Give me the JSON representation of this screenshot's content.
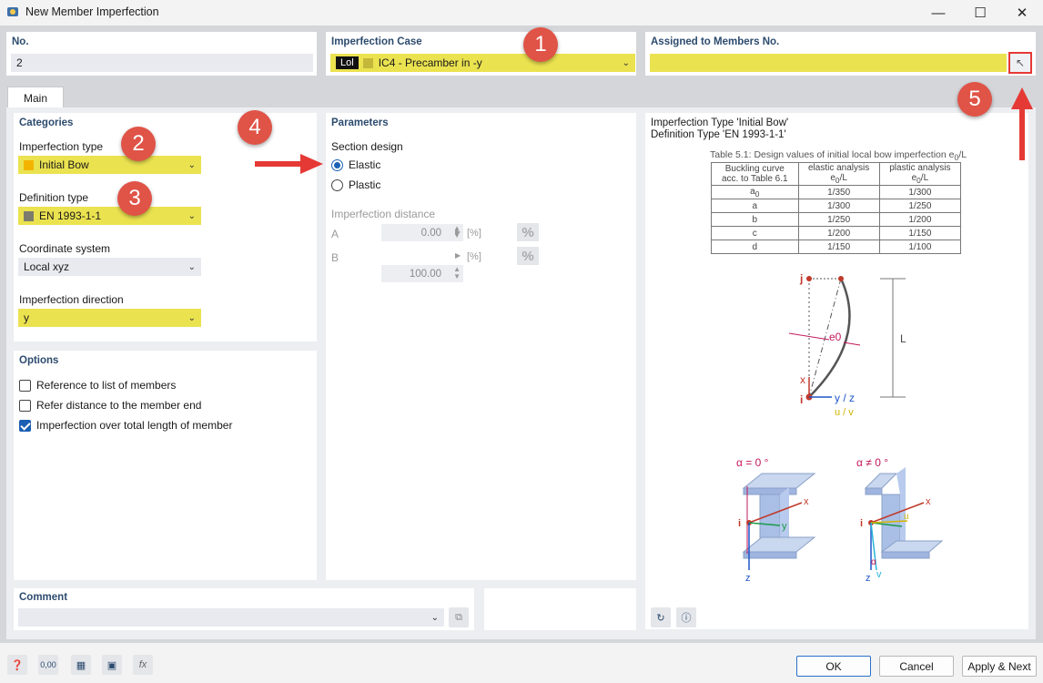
{
  "window": {
    "title": "New Member Imperfection"
  },
  "header": {
    "no_label": "No.",
    "no_value": "2",
    "case_label": "Imperfection Case",
    "case_tag": "Lol",
    "case_value": "IC4 -  Precamber in -y",
    "assigned_label": "Assigned to Members No.",
    "assigned_value": ""
  },
  "tabs": [
    {
      "label": "Main"
    }
  ],
  "categories": {
    "title": "Categories",
    "imperfection_type_label": "Imperfection type",
    "imperfection_type_value": "Initial Bow",
    "imperfection_type_color": "#f3b400",
    "definition_type_label": "Definition type",
    "definition_type_value": "EN 1993-1-1",
    "definition_type_color": "#7c7c6e",
    "coord_label": "Coordinate system",
    "coord_value": "Local xyz",
    "direction_label": "Imperfection direction",
    "direction_value": "y"
  },
  "options": {
    "title": "Options",
    "items": [
      {
        "label": "Reference to list of members",
        "checked": false
      },
      {
        "label": "Refer distance to the member end",
        "checked": false
      },
      {
        "label": "Imperfection over total length of member",
        "checked": true
      }
    ]
  },
  "parameters": {
    "title": "Parameters",
    "section_design_label": "Section design",
    "radio_elastic": "Elastic",
    "radio_plastic": "Plastic",
    "selected": "Elastic",
    "distance_label": "Imperfection distance",
    "rows": [
      {
        "name": "A",
        "value": "0.00",
        "unit": "[%]"
      },
      {
        "name": "B",
        "value": "100.00",
        "unit": "[%]"
      }
    ],
    "pct_symbol": "%"
  },
  "info": {
    "line1": "Imperfection Type 'Initial Bow'",
    "line2": "Definition Type 'EN 1993-1-1'",
    "table_caption": "Table 5.1: Design values of initial local bow imperfection e0/L",
    "table_head": [
      [
        "Buckling curve",
        "acc. to Table 6.1"
      ],
      [
        "elastic analysis",
        "e0/L"
      ],
      [
        "plastic analysis",
        "e0/L"
      ]
    ],
    "table_rows": [
      [
        "a0",
        "1/350",
        "1/300"
      ],
      [
        "a",
        "1/300",
        "1/250"
      ],
      [
        "b",
        "1/250",
        "1/200"
      ],
      [
        "c",
        "1/200",
        "1/150"
      ],
      [
        "d",
        "1/150",
        "1/100"
      ]
    ],
    "diagram": {
      "j": "j",
      "i": "i",
      "x": "x",
      "e0": "e0",
      "L": "L",
      "yz": "y / z",
      "uv": "u / v"
    },
    "section_left": {
      "alpha": "α = 0 °",
      "x": "x",
      "y": "y",
      "z": "z",
      "i": "i"
    },
    "section_right": {
      "alpha": "α ≠ 0 °",
      "x": "x",
      "u": "u",
      "v": "v",
      "z": "z",
      "i": "i",
      "a": "α"
    }
  },
  "comment": {
    "label": "Comment",
    "value": ""
  },
  "badges": [
    "1",
    "2",
    "3",
    "4",
    "5"
  ],
  "footer": {
    "ok": "OK",
    "cancel": "Cancel",
    "apply_next": "Apply & Next"
  },
  "colors": {
    "accent_yellow": "#ebe250",
    "badge_red": "#e05347",
    "arrow_red": "#e53935",
    "header_blue": "#2c4b6e"
  }
}
